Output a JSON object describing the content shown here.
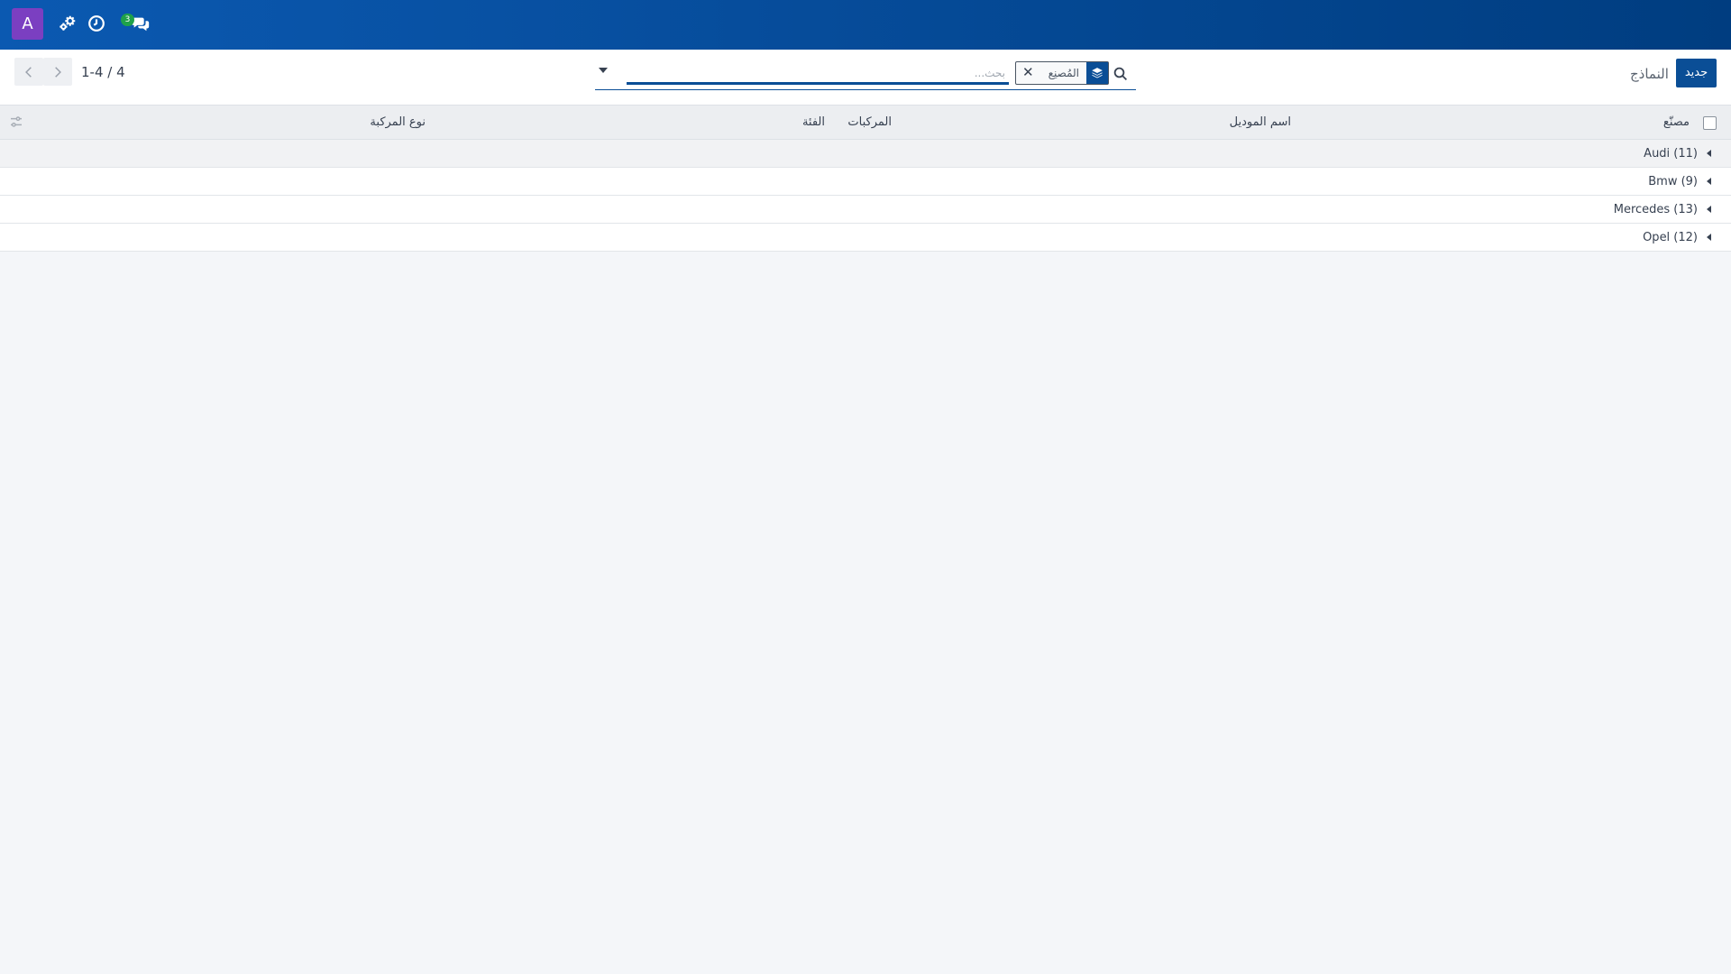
{
  "navbar": {
    "avatar_letter": "A",
    "chat_count": "3",
    "icons": [
      "settings-icon",
      "clock-icon",
      "chat-icon"
    ]
  },
  "control_panel": {
    "new_button": "جديد",
    "breadcrumb": "النماذج",
    "search": {
      "placeholder": "بحث...",
      "facet_label": "المُصنِع",
      "facet_icon": "layers-icon"
    },
    "pager": {
      "value": "1-4 / 4"
    }
  },
  "table": {
    "columns": {
      "manufacturer": "مصنّع",
      "model_name": "اسم الموديل",
      "vehicles": "المركبات",
      "category": "الفئة",
      "vehicle_type": "نوع المركبة"
    },
    "groups": [
      {
        "label": "Audi (11)"
      },
      {
        "label": "Bmw (9)"
      },
      {
        "label": "Mercedes (13)"
      },
      {
        "label": "Opel (12)"
      }
    ]
  },
  "colors": {
    "navbar_start": "#0b59b1",
    "navbar_end": "#003d80",
    "primary": "#0a4e96",
    "avatar": "#7b3fc1",
    "badge": "#1fa14a"
  }
}
